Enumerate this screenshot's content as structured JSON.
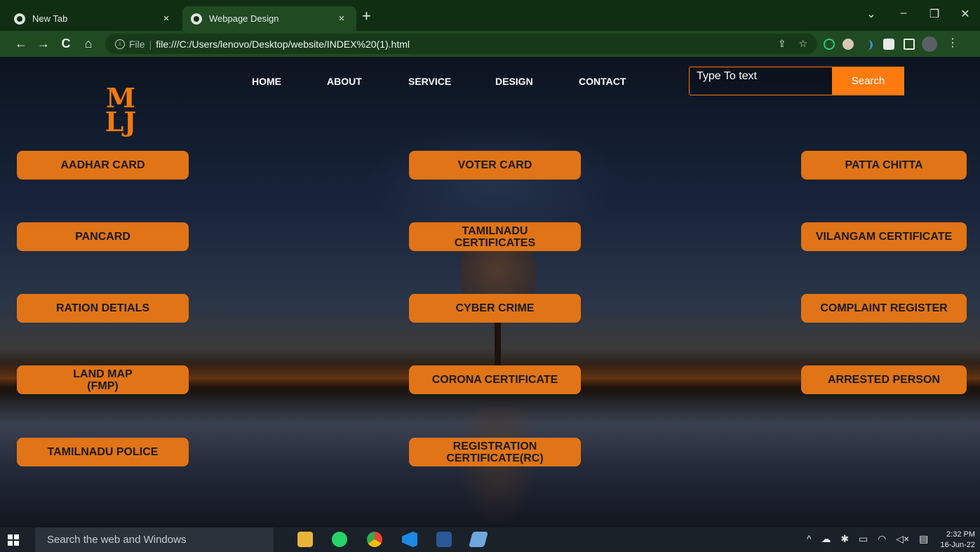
{
  "browser": {
    "tabs": [
      {
        "label": "New Tab",
        "close": "×"
      },
      {
        "label": "Webpage Design",
        "close": "×"
      }
    ],
    "new_tab": "+",
    "window_controls": {
      "menu": "⌄",
      "minimize": "–",
      "restore": "❐",
      "close": "✕"
    },
    "nav": {
      "back": "←",
      "forward": "→",
      "reload": "C",
      "home": "⌂"
    },
    "address": {
      "scheme": "File",
      "url": "file:///C:/Users/lenovo/Desktop/website/INDEX%20(1).html"
    },
    "toolbar_icons": [
      "share-icon",
      "star-icon",
      "extension-icons",
      "puzzle-icon",
      "sidebar-icon",
      "profile-avatar",
      "menu-icon"
    ]
  },
  "site": {
    "logo": {
      "line1": "M",
      "line2": "LJ"
    },
    "nav": [
      "HOME",
      "ABOUT",
      "SERVICE",
      "DESIGN",
      "CONTACT"
    ],
    "search": {
      "placeholder": "Type To text",
      "button": "Search"
    },
    "services_left": [
      "AADHAR CARD",
      "PANCARD",
      "RATION DETIALS",
      "LAND MAP\n(FMP)",
      "TAMILNADU POLICE"
    ],
    "services_center": [
      "VOTER CARD",
      "TAMILNADU\nCERTIFICATES",
      "CYBER CRIME",
      "CORONA CERTIFICATE",
      "REGISTRATION\nCERTIFICATE(RC)"
    ],
    "services_right": [
      "PATTA CHITTA",
      "VILANGAM CERTIFICATE",
      "COMPLAINT REGISTER",
      "ARRESTED PERSON"
    ],
    "colors": {
      "accent": "#e07417",
      "search_button": "#ff7b10",
      "logo": "#f07a10"
    }
  },
  "taskbar": {
    "search_placeholder": "Search the web and Windows",
    "time": "2:32 PM",
    "date": "16-Jun-22"
  }
}
